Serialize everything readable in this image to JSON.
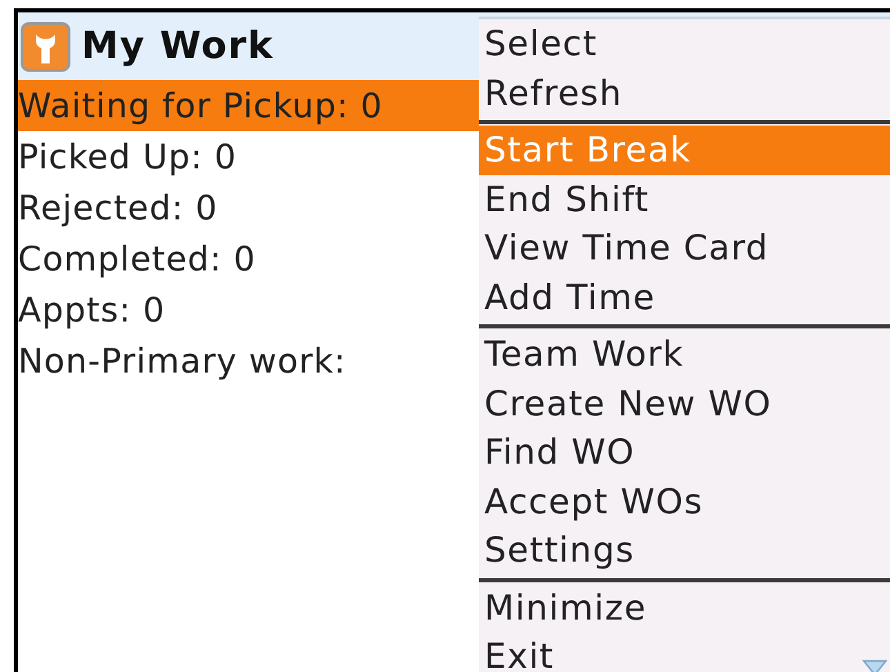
{
  "header": {
    "title": "My Work"
  },
  "work_list": [
    {
      "label": "Waiting for Pickup: 0",
      "selected": true
    },
    {
      "label": "Picked Up: 0",
      "selected": false
    },
    {
      "label": "Rejected: 0",
      "selected": false
    },
    {
      "label": "Completed: 0",
      "selected": false
    },
    {
      "label": "Appts: 0",
      "selected": false
    },
    {
      "label": "Non-Primary work:",
      "selected": false
    }
  ],
  "menu": {
    "groups": [
      {
        "items": [
          {
            "label": "Select",
            "selected": false
          },
          {
            "label": "Refresh",
            "selected": false
          }
        ]
      },
      {
        "items": [
          {
            "label": "Start Break",
            "selected": true
          },
          {
            "label": "End Shift",
            "selected": false
          },
          {
            "label": "View Time Card",
            "selected": false
          },
          {
            "label": "Add Time",
            "selected": false
          }
        ]
      },
      {
        "items": [
          {
            "label": "Team Work",
            "selected": false
          },
          {
            "label": "Create New WO",
            "selected": false
          },
          {
            "label": "Find WO",
            "selected": false
          },
          {
            "label": "Accept WOs",
            "selected": false
          },
          {
            "label": "Settings",
            "selected": false
          }
        ]
      },
      {
        "items": [
          {
            "label": "Minimize",
            "selected": false
          },
          {
            "label": "Exit",
            "selected": false
          }
        ]
      }
    ]
  }
}
